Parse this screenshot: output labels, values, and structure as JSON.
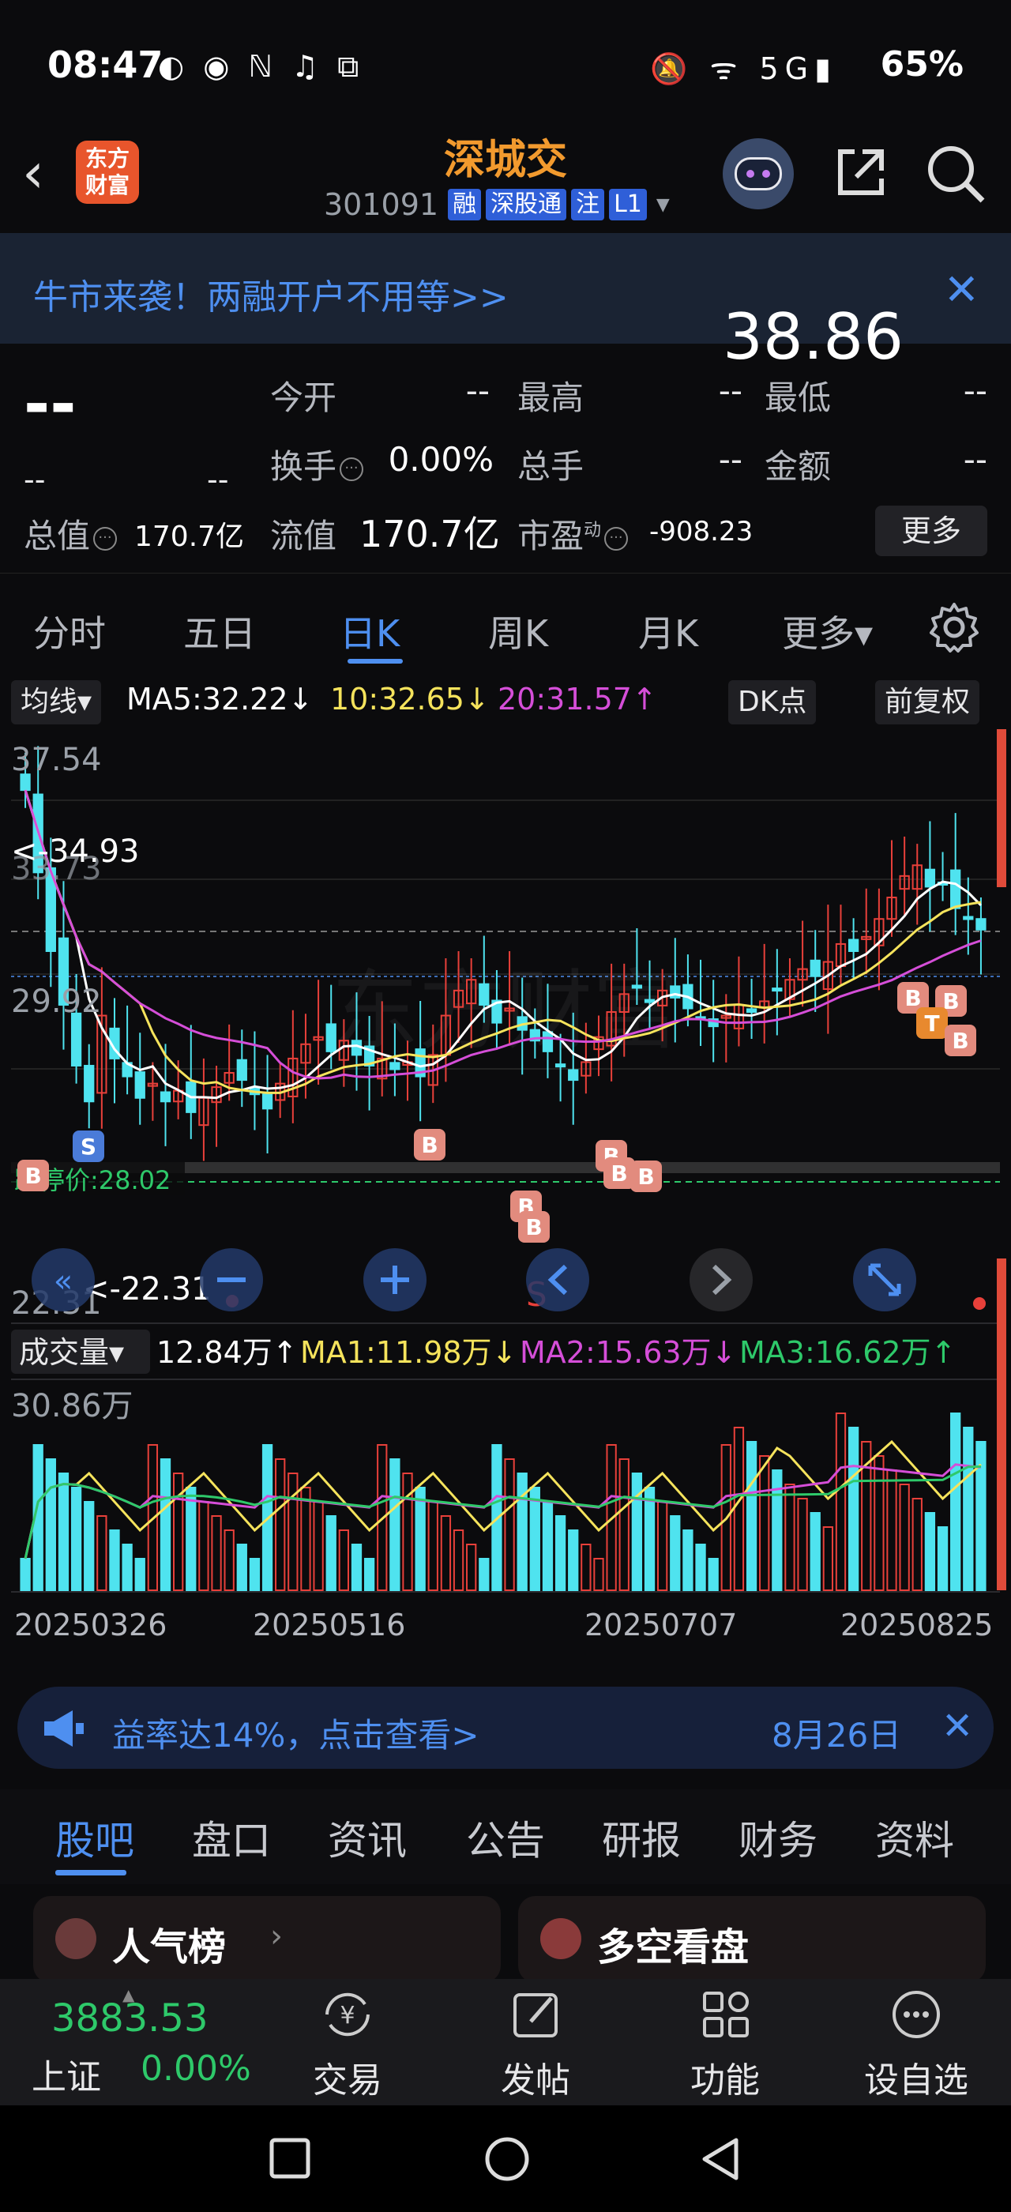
{
  "status": {
    "time": "08:47",
    "left_icons": "◐ ◉ ℕ ♫ ⧉",
    "right_icons": "🔕 ᯤ 5G▮",
    "battery": "65%"
  },
  "header": {
    "logo_text": "东方财富",
    "stock_name": "深城交",
    "code": "301091",
    "tags": [
      "融",
      "深股通",
      "注",
      "L1"
    ]
  },
  "promo": {
    "text": "牛市来袭！两融开户不用等>>",
    "big_price": "38.86"
  },
  "quote": {
    "price": "--",
    "change_abs": "--",
    "change_pct": "--",
    "open_label": "今开",
    "open_value": "--",
    "high_label": "最高",
    "high_value": "--",
    "low_label": "最低",
    "low_value": "--",
    "turnover_label": "换手",
    "turnover_value": "0.00%",
    "vol_label": "总手",
    "vol_value": "--",
    "amount_label": "金额",
    "amount_value": "--",
    "mcap_label": "总值",
    "mcap_value": "170.7亿",
    "float_label": "流值",
    "float_value": "170.7亿",
    "pe_label": "市盈",
    "pe_sup": "动",
    "pe_value": "-908.23",
    "more_label": "更多"
  },
  "period_tabs": [
    "分时",
    "五日",
    "日K",
    "周K",
    "月K",
    "更多▾"
  ],
  "indicators": {
    "ma_label": "均线▾",
    "ma5": "MA5:32.22↓",
    "ma10": "10:32.65↓",
    "ma20": "20:31.57↑",
    "dk_label": "DK点",
    "adjust_label": "前复权",
    "vol_label": "成交量▾",
    "vol_now": "12.84万↑",
    "vol_ma1": "MA1:11.98万↓",
    "vol_ma2": "MA2:15.63万↓",
    "vol_ma3": "MA3:16.62万↑"
  },
  "chart_data": {
    "type": "candlestick",
    "price_axis": {
      "top_label": "37.54",
      "mid_label": "29.92",
      "bottom_label": "22.31",
      "ylim": [
        22.31,
        37.54
      ]
    },
    "hidden_label": "33.73",
    "annotations": {
      "high_mark": "<-34.93",
      "low_mark": "<-22.31",
      "limit_down": "跌停价:28.02"
    },
    "signal_letters": [
      "B",
      "S",
      "T"
    ],
    "volume_axis": {
      "top_label": "30.86万"
    },
    "x_ticks": [
      "20250326",
      "20250516",
      "20250707",
      "20250825"
    ],
    "close_approx": [
      36.5,
      34.2,
      32.0,
      30.5,
      28.8,
      27.8,
      30.2,
      29.0,
      28.5,
      27.9,
      28.3,
      27.8,
      28.1,
      27.5,
      27.9,
      28.2,
      28.6,
      28.4,
      28.0,
      27.6,
      28.3,
      29.0,
      29.4,
      29.6,
      29.2,
      29.5,
      29.1,
      28.8,
      29.0,
      28.7,
      28.9,
      28.5,
      29.1,
      30.2,
      30.9,
      31.2,
      30.5,
      30.0,
      30.4,
      29.8,
      29.5,
      29.2,
      28.8,
      28.4,
      28.9,
      29.6,
      30.3,
      30.8,
      31.0,
      30.6,
      30.9,
      30.7,
      30.4,
      30.1,
      29.9,
      30.2,
      30.5,
      30.3,
      30.6,
      30.9,
      31.2,
      31.5,
      31.3,
      31.7,
      32.2,
      32.0,
      32.4,
      32.9,
      33.5,
      34.1,
      34.4,
      33.8,
      33.9,
      33.2,
      32.9,
      32.6
    ]
  },
  "notice": {
    "text": "益率达14%，点击查看>",
    "date": "8月26日"
  },
  "content_tabs": [
    "股吧",
    "盘口",
    "资讯",
    "公告",
    "研报",
    "财务",
    "资料"
  ],
  "cards": [
    "人气榜",
    "多空看盘"
  ],
  "bottom_nav": {
    "index_value": "3883.53",
    "index_name": "上证",
    "index_change": "0.00%",
    "items": [
      "交易",
      "发帖",
      "功能",
      "设自选"
    ]
  },
  "colors": {
    "up": "#e8403a",
    "down": "#4fe3ef",
    "ma5": "#ffffff",
    "ma10": "#f5e35c",
    "ma20": "#d54ed8",
    "accent": "#4e8ff0"
  }
}
